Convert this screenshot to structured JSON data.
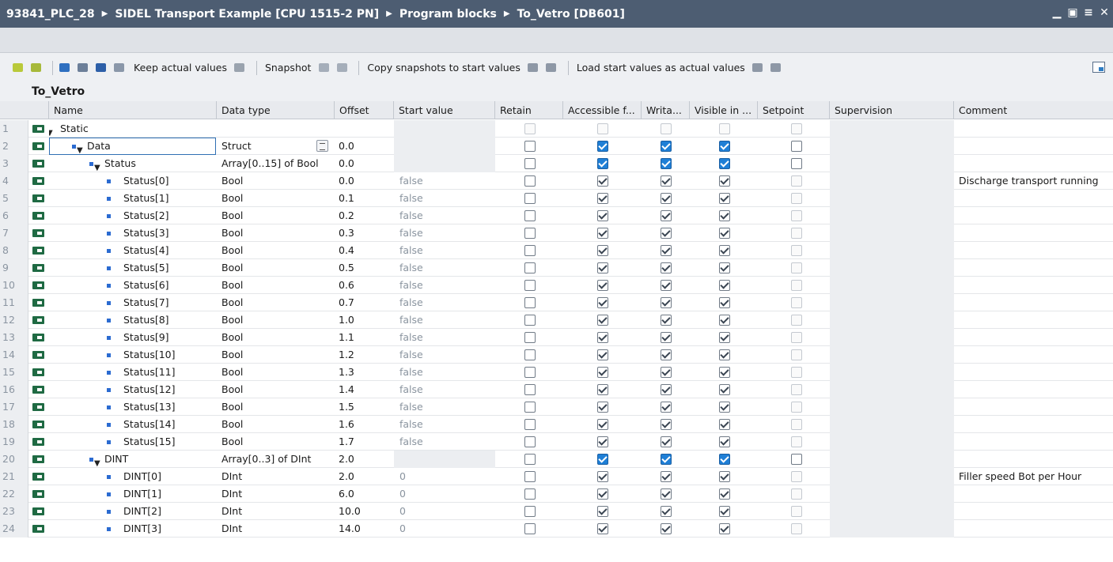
{
  "titlebar": {
    "crumbs": [
      "93841_PLC_28",
      "SIDEL Transport Example [CPU 1515-2 PN]",
      "Program blocks",
      "To_Vetro [DB601]"
    ],
    "separator": "▶"
  },
  "toolbar": {
    "keep_actual": "Keep actual values",
    "snapshot": "Snapshot",
    "copy_snapshots": "Copy snapshots to start values",
    "load_start": "Load start values as actual values"
  },
  "block": {
    "title": "To_Vetro"
  },
  "columns": {
    "name": "Name",
    "data_type": "Data type",
    "offset": "Offset",
    "start_value": "Start value",
    "retain": "Retain",
    "accessible": "Accessible f...",
    "writable": "Writa...",
    "visible": "Visible in ...",
    "setpoint": "Setpoint",
    "supervision": "Supervision",
    "comment": "Comment"
  },
  "rows": [
    {
      "n": "1",
      "name": "Static",
      "type": "",
      "offset": "",
      "start": "",
      "comment": "",
      "indent": 0,
      "expand": true,
      "dot": false,
      "kind": "root"
    },
    {
      "n": "2",
      "name": "Data",
      "type": "Struct",
      "offset": "0.0",
      "start": "",
      "comment": "",
      "indent": 1,
      "expand": true,
      "dot": true,
      "kind": "struct"
    },
    {
      "n": "3",
      "name": "Status",
      "type": "Array[0..15] of Bool",
      "offset": "0.0",
      "start": "",
      "comment": "",
      "indent": 2,
      "expand": true,
      "dot": true,
      "kind": "struct"
    },
    {
      "n": "4",
      "name": "Status[0]",
      "type": "Bool",
      "offset": "0.0",
      "start": "false",
      "comment": "Discharge transport running",
      "indent": 3,
      "expand": false,
      "dot": true,
      "kind": "leaf"
    },
    {
      "n": "5",
      "name": "Status[1]",
      "type": "Bool",
      "offset": "0.1",
      "start": "false",
      "comment": "",
      "indent": 3,
      "expand": false,
      "dot": true,
      "kind": "leaf"
    },
    {
      "n": "6",
      "name": "Status[2]",
      "type": "Bool",
      "offset": "0.2",
      "start": "false",
      "comment": "",
      "indent": 3,
      "expand": false,
      "dot": true,
      "kind": "leaf"
    },
    {
      "n": "7",
      "name": "Status[3]",
      "type": "Bool",
      "offset": "0.3",
      "start": "false",
      "comment": "",
      "indent": 3,
      "expand": false,
      "dot": true,
      "kind": "leaf"
    },
    {
      "n": "8",
      "name": "Status[4]",
      "type": "Bool",
      "offset": "0.4",
      "start": "false",
      "comment": "",
      "indent": 3,
      "expand": false,
      "dot": true,
      "kind": "leaf"
    },
    {
      "n": "9",
      "name": "Status[5]",
      "type": "Bool",
      "offset": "0.5",
      "start": "false",
      "comment": "",
      "indent": 3,
      "expand": false,
      "dot": true,
      "kind": "leaf"
    },
    {
      "n": "10",
      "name": "Status[6]",
      "type": "Bool",
      "offset": "0.6",
      "start": "false",
      "comment": "",
      "indent": 3,
      "expand": false,
      "dot": true,
      "kind": "leaf"
    },
    {
      "n": "11",
      "name": "Status[7]",
      "type": "Bool",
      "offset": "0.7",
      "start": "false",
      "comment": "",
      "indent": 3,
      "expand": false,
      "dot": true,
      "kind": "leaf"
    },
    {
      "n": "12",
      "name": "Status[8]",
      "type": "Bool",
      "offset": "1.0",
      "start": "false",
      "comment": "",
      "indent": 3,
      "expand": false,
      "dot": true,
      "kind": "leaf"
    },
    {
      "n": "13",
      "name": "Status[9]",
      "type": "Bool",
      "offset": "1.1",
      "start": "false",
      "comment": "",
      "indent": 3,
      "expand": false,
      "dot": true,
      "kind": "leaf"
    },
    {
      "n": "14",
      "name": "Status[10]",
      "type": "Bool",
      "offset": "1.2",
      "start": "false",
      "comment": "",
      "indent": 3,
      "expand": false,
      "dot": true,
      "kind": "leaf"
    },
    {
      "n": "15",
      "name": "Status[11]",
      "type": "Bool",
      "offset": "1.3",
      "start": "false",
      "comment": "",
      "indent": 3,
      "expand": false,
      "dot": true,
      "kind": "leaf"
    },
    {
      "n": "16",
      "name": "Status[12]",
      "type": "Bool",
      "offset": "1.4",
      "start": "false",
      "comment": "",
      "indent": 3,
      "expand": false,
      "dot": true,
      "kind": "leaf"
    },
    {
      "n": "17",
      "name": "Status[13]",
      "type": "Bool",
      "offset": "1.5",
      "start": "false",
      "comment": "",
      "indent": 3,
      "expand": false,
      "dot": true,
      "kind": "leaf"
    },
    {
      "n": "18",
      "name": "Status[14]",
      "type": "Bool",
      "offset": "1.6",
      "start": "false",
      "comment": "",
      "indent": 3,
      "expand": false,
      "dot": true,
      "kind": "leaf"
    },
    {
      "n": "19",
      "name": "Status[15]",
      "type": "Bool",
      "offset": "1.7",
      "start": "false",
      "comment": "",
      "indent": 3,
      "expand": false,
      "dot": true,
      "kind": "leaf"
    },
    {
      "n": "20",
      "name": "DINT",
      "type": "Array[0..3] of DInt",
      "offset": "2.0",
      "start": "",
      "comment": "",
      "indent": 2,
      "expand": true,
      "dot": true,
      "kind": "struct"
    },
    {
      "n": "21",
      "name": "DINT[0]",
      "type": "DInt",
      "offset": "2.0",
      "start": "0",
      "comment": "Filler speed Bot per Hour",
      "indent": 3,
      "expand": false,
      "dot": true,
      "kind": "leaf"
    },
    {
      "n": "22",
      "name": "DINT[1]",
      "type": "DInt",
      "offset": "6.0",
      "start": "0",
      "comment": "",
      "indent": 3,
      "expand": false,
      "dot": true,
      "kind": "leaf"
    },
    {
      "n": "23",
      "name": "DINT[2]",
      "type": "DInt",
      "offset": "10.0",
      "start": "0",
      "comment": "",
      "indent": 3,
      "expand": false,
      "dot": true,
      "kind": "leaf"
    },
    {
      "n": "24",
      "name": "DINT[3]",
      "type": "DInt",
      "offset": "14.0",
      "start": "0",
      "comment": "",
      "indent": 3,
      "expand": false,
      "dot": true,
      "kind": "leaf"
    }
  ],
  "icons": {
    "window": [
      "minimize-icon",
      "restore-icon",
      "tile-icon",
      "close-icon"
    ],
    "toolbar": [
      "insert-row-icon",
      "add-row-icon",
      "expand-all-icon",
      "collapse-all-icon",
      "list-icon",
      "monitor-icon"
    ]
  },
  "colors": {
    "titlebar": "#4d5d72",
    "check_blue": "#1f7fd6",
    "tag_green": "#1f6a43",
    "dot_blue": "#2b6bd1"
  }
}
